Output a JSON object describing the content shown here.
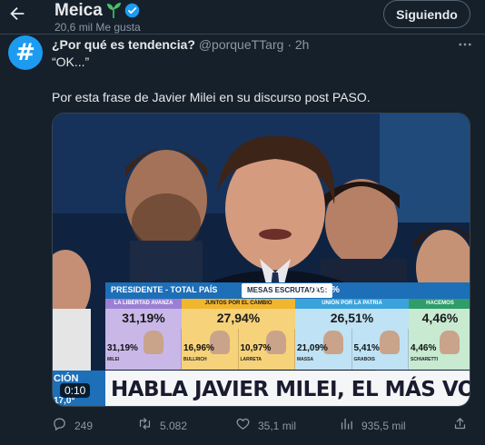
{
  "header": {
    "title": "Meica",
    "subtitle": "20,6 mil Me gusta",
    "follow_label": "Siguiendo"
  },
  "tweet": {
    "author": "¿Por qué es tendencia?",
    "handle": "@porqueTTarg",
    "separator": "·",
    "time": "2h",
    "line1": "“OK...”",
    "line2": "Por esta frase de Javier Milei en su discurso post PASO."
  },
  "media": {
    "graphic_title": "PRESIDENTE - TOTAL PAÍS",
    "mesas_label": "MESAS ESCRUTADAS:",
    "mesas_value": "77,45%",
    "parties": [
      {
        "name": "LA LIBERTAD AVANZA",
        "total": "31,19%",
        "candidates": [
          {
            "value": "31,19%",
            "name": "MILEI"
          }
        ]
      },
      {
        "name": "JUNTOS POR EL CAMBIO",
        "total": "27,94%",
        "candidates": [
          {
            "value": "16,96%",
            "name": "BULLRICH"
          },
          {
            "value": "10,97%",
            "name": "LARRETA"
          }
        ]
      },
      {
        "name": "UNIÓN POR LA PATRIA",
        "total": "26,51%",
        "candidates": [
          {
            "value": "21,09%",
            "name": "MASSA"
          },
          {
            "value": "5,41%",
            "name": "GRABOIS"
          }
        ]
      },
      {
        "name": "HACEMOS",
        "total": "4,46%",
        "candidates": [
          {
            "value": "4,46%",
            "name": "SCHIARETTI"
          }
        ]
      }
    ],
    "banner": "HABLA JAVIER MILEI, EL MÁS VOTADO",
    "left_label": "CIÓN",
    "left_label_bottom": "17,0°",
    "timer": "0:10"
  },
  "actions": {
    "replies": "249",
    "retweets": "5.082",
    "likes": "35,1 mil",
    "views": "935,5 mil"
  },
  "icons": {
    "back": "arrow-left-icon",
    "verified": "verified-badge-icon",
    "more": "more-options-icon",
    "reply": "reply-icon",
    "retweet": "retweet-icon",
    "like": "heart-icon",
    "views": "views-icon",
    "share": "share-icon"
  },
  "colors": {
    "background": "#15202b",
    "accent": "#1d9bf0",
    "muted": "#8b98a5"
  }
}
